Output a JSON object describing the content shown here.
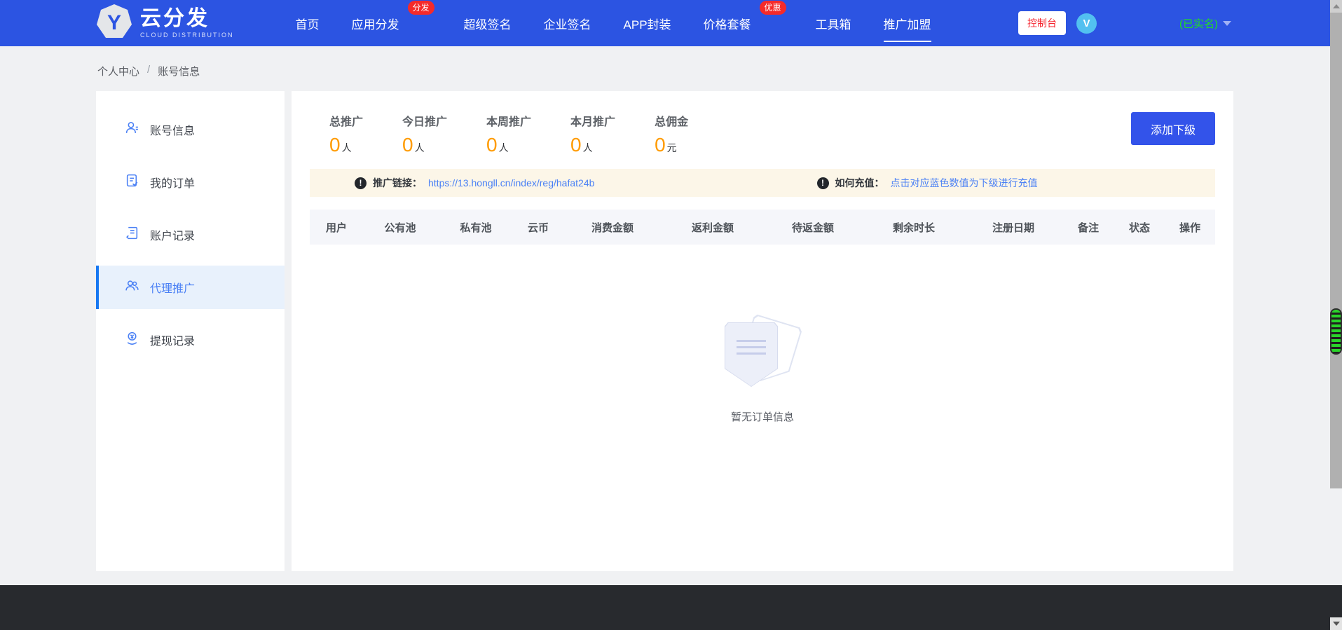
{
  "nav": {
    "logo": {
      "letter": "Y",
      "text": "云分发",
      "subtext": "CLOUD DISTRIBUTION"
    },
    "items": [
      {
        "label": "首页"
      },
      {
        "label": "应用分发",
        "badge": "分发"
      },
      {
        "label": "超级签名"
      },
      {
        "label": "企业签名"
      },
      {
        "label": "APP封装"
      },
      {
        "label": "价格套餐",
        "badge": "优惠"
      },
      {
        "label": "工具箱"
      },
      {
        "label": "推广加盟"
      }
    ],
    "console_button": "控制台",
    "avatar_letter": "V",
    "user_status": "(已实名)"
  },
  "breadcrumb": {
    "items": [
      "个人中心",
      "账号信息"
    ],
    "separator": "/"
  },
  "sidebar": {
    "items": [
      {
        "label": "账号信息"
      },
      {
        "label": "我的订单"
      },
      {
        "label": "账户记录"
      },
      {
        "label": "代理推广"
      },
      {
        "label": "提现记录"
      }
    ]
  },
  "main": {
    "stats": [
      {
        "label": "总推广",
        "value": "0",
        "unit": "人"
      },
      {
        "label": "今日推广",
        "value": "0",
        "unit": "人"
      },
      {
        "label": "本周推广",
        "value": "0",
        "unit": "人"
      },
      {
        "label": "本月推广",
        "value": "0",
        "unit": "人"
      },
      {
        "label": "总佣金",
        "value": "0",
        "unit": "元"
      }
    ],
    "add_button": "添加下級",
    "notice": {
      "info_mark": "!",
      "link_label": "推广链接：",
      "link_url": "https://13.hongll.cn/index/reg/hafat24b",
      "recharge_label": "如何充值：",
      "recharge_text": "点击对应蓝色数值为下级进行充值"
    },
    "table": {
      "headers": [
        "用户",
        "公有池",
        "私有池",
        "云币",
        "消费金额",
        "返利金额",
        "待返金额",
        "剩余时长",
        "注册日期",
        "备注",
        "状态",
        "操作"
      ]
    },
    "empty_text": "暂无订单信息"
  },
  "colors": {
    "navbar_blue": "#2c54e2",
    "accent_button_blue": "#3353ea",
    "badge_red": "#f52a2a",
    "console_red": "#f5222d",
    "avatar_blue": "#52c0f0",
    "verified_green": "#21df21",
    "stat_orange": "#ff9b00",
    "link_blue": "#4a80f5",
    "banner_cream": "#fcf6e8",
    "sidebar_active_bg": "#e8f1fc",
    "sidebar_active_border": "#1778f2",
    "footer_dark": "#282a2e"
  }
}
